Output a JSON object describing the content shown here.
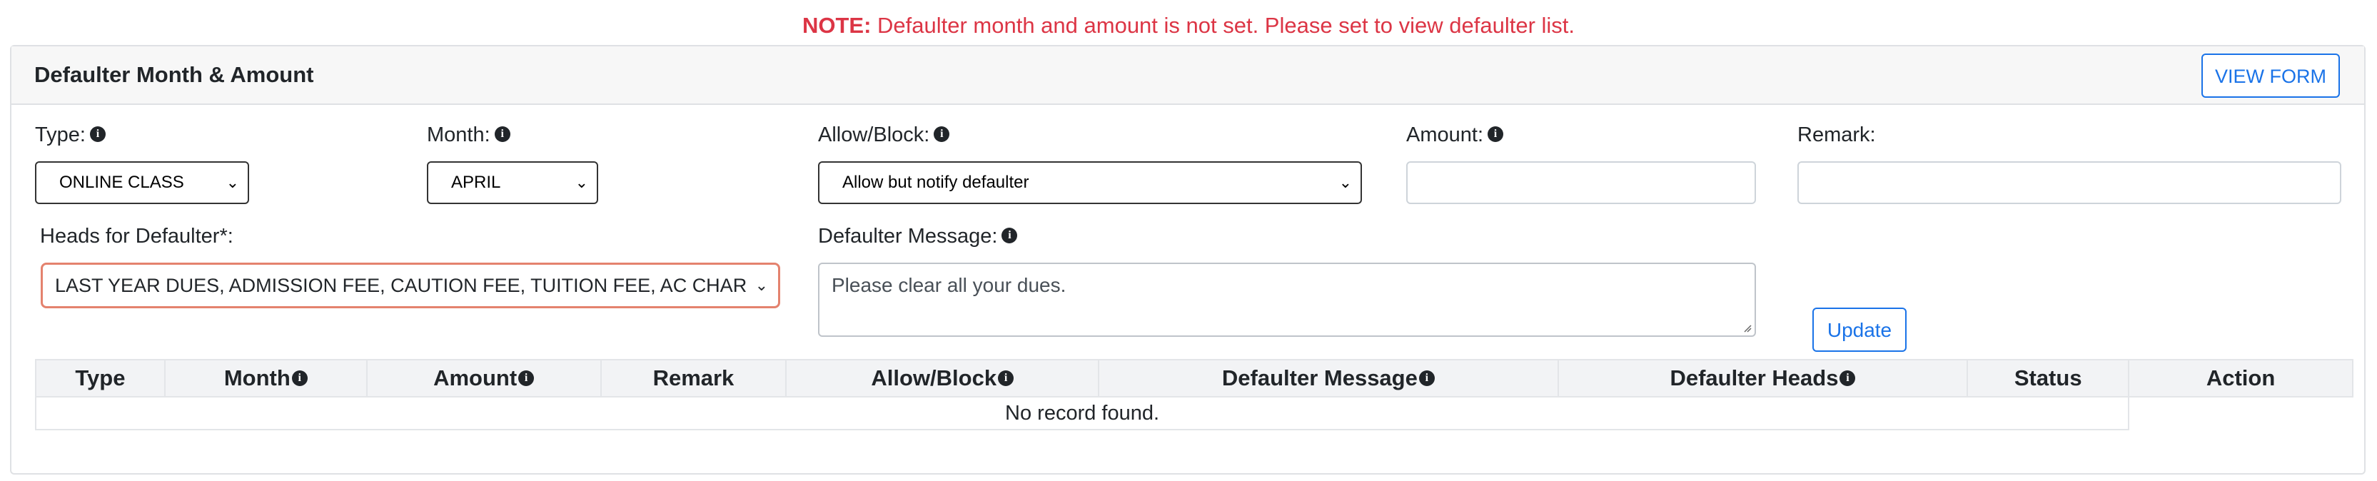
{
  "note": {
    "prefix": "NOTE:",
    "message": " Defaulter month and amount is not set. Please set to view defaulter list."
  },
  "card": {
    "title": "Defaulter Month & Amount",
    "view_form_label": "VIEW FORM"
  },
  "form": {
    "type": {
      "label": "Type:",
      "value": "ONLINE CLASS"
    },
    "month": {
      "label": "Month:",
      "value": "APRIL"
    },
    "allow_block": {
      "label": "Allow/Block:",
      "value": "Allow but notify defaulter"
    },
    "amount": {
      "label": "Amount:",
      "value": ""
    },
    "remark": {
      "label": "Remark:",
      "value": ""
    },
    "heads": {
      "label": "Heads for Defaulter*:",
      "value": "LAST YEAR DUES, ADMISSION FEE, CAUTION FEE, TUITION FEE, AC CHAR"
    },
    "message": {
      "label": "Defaulter Message:",
      "value": "Please clear all your dues."
    },
    "update_label": "Update"
  },
  "table": {
    "columns": [
      "Type",
      "Month",
      "Amount",
      "Remark",
      "Allow/Block",
      "Defaulter Message",
      "Defaulter Heads",
      "Status",
      "Action"
    ],
    "empty_text": "No record found."
  },
  "icons": {
    "info": "info-icon",
    "chevron": "chevron-down-icon"
  },
  "colors": {
    "note": "#dc3545",
    "accent": "#1a73e8",
    "invalid_border": "#e4826e"
  }
}
